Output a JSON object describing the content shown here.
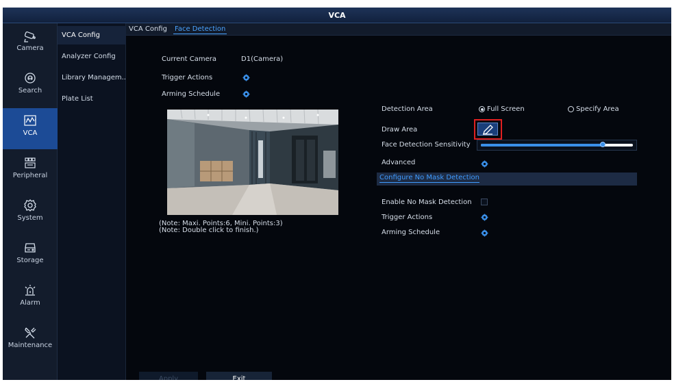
{
  "window": {
    "title": "VCA"
  },
  "nav_rail": {
    "items": [
      {
        "label": "Camera",
        "icon": "camera-icon"
      },
      {
        "label": "Search",
        "icon": "search-icon"
      },
      {
        "label": "VCA",
        "icon": "vca-icon",
        "active": true
      },
      {
        "label": "Peripheral",
        "icon": "peripheral-icon"
      },
      {
        "label": "System",
        "icon": "system-gear-icon"
      },
      {
        "label": "Storage",
        "icon": "storage-icon"
      },
      {
        "label": "Alarm",
        "icon": "alarm-icon"
      },
      {
        "label": "Maintenance",
        "icon": "maintenance-icon"
      }
    ]
  },
  "submenu": {
    "items": [
      {
        "label": "VCA Config",
        "active": true
      },
      {
        "label": "Analyzer Config"
      },
      {
        "label": "Library Managem..."
      },
      {
        "label": "Plate List"
      }
    ]
  },
  "tabs": {
    "breadcrumb": "VCA Config",
    "active": "Face Detection"
  },
  "form": {
    "current_camera_label": "Current Camera",
    "current_camera_value": "D1(Camera)",
    "trigger_actions_label": "Trigger Actions",
    "arming_schedule_label": "Arming Schedule"
  },
  "notes": {
    "line1": "(Note: Maxi. Points:6, Mini. Points:3)",
    "line2": "(Note: Double click to finish.)"
  },
  "detection": {
    "detection_area_label": "Detection Area",
    "options": [
      "Full Screen",
      "Specify Area"
    ],
    "selected_option": "Full Screen",
    "draw_area_label": "Draw Area",
    "sensitivity_label": "Face Detection Sensitivity",
    "sensitivity_fraction": 0.8,
    "advanced_label": "Advanced"
  },
  "no_mask": {
    "section_title": "Configure No Mask Detection",
    "enable_label": "Enable No Mask Detection",
    "enabled": false,
    "trigger_actions_label": "Trigger Actions",
    "arming_schedule_label": "Arming Schedule"
  },
  "buttons": {
    "apply": "Apply",
    "exit": "Exit"
  },
  "colors": {
    "accent": "#3f9bff",
    "nav_active": "#1c4b96",
    "highlight": "#e02020"
  }
}
